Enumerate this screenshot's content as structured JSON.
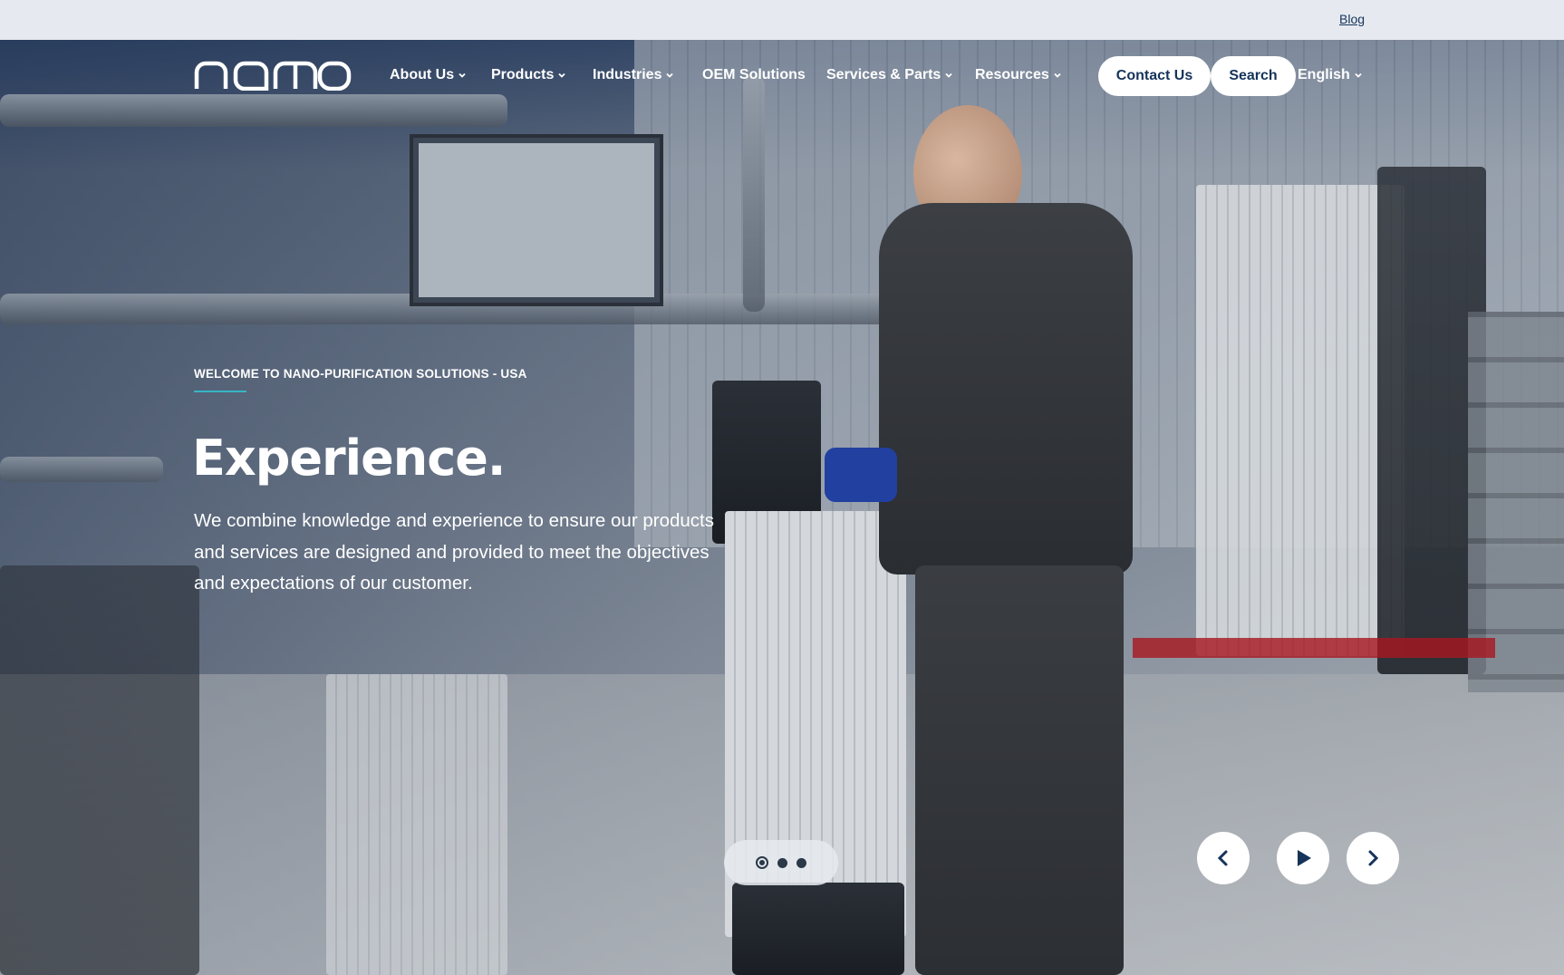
{
  "utility": {
    "blog_label": "Blog"
  },
  "header": {
    "logo_text": "nano",
    "nav": [
      {
        "label": "About Us",
        "has_menu": true
      },
      {
        "label": "Products",
        "has_menu": true
      },
      {
        "label": "Industries",
        "has_menu": true
      },
      {
        "label": "OEM Solutions",
        "has_menu": false
      },
      {
        "label": "Services & Parts",
        "has_menu": true
      },
      {
        "label": "Resources",
        "has_menu": true
      }
    ],
    "contact_label": "Contact Us",
    "search_label": "Search",
    "language_label": "English"
  },
  "hero": {
    "eyebrow": "WELCOME TO NANO-PURIFICATION SOLUTIONS - USA",
    "headline": "Experience.",
    "lede": "We combine knowledge and experience to ensure our products and services are designed and provided to meet the objectives and expectations of our customer.",
    "slide_count": 3,
    "active_slide": 1
  },
  "icons": {
    "chevron": "chevron-down-icon",
    "prev": "chevron-left-icon",
    "play": "play-icon",
    "next": "chevron-right-icon"
  },
  "colors": {
    "navy": "#16335a",
    "accent_teal": "#35b6c4",
    "white": "#ffffff",
    "utility_bg": "#e6eaf0"
  }
}
